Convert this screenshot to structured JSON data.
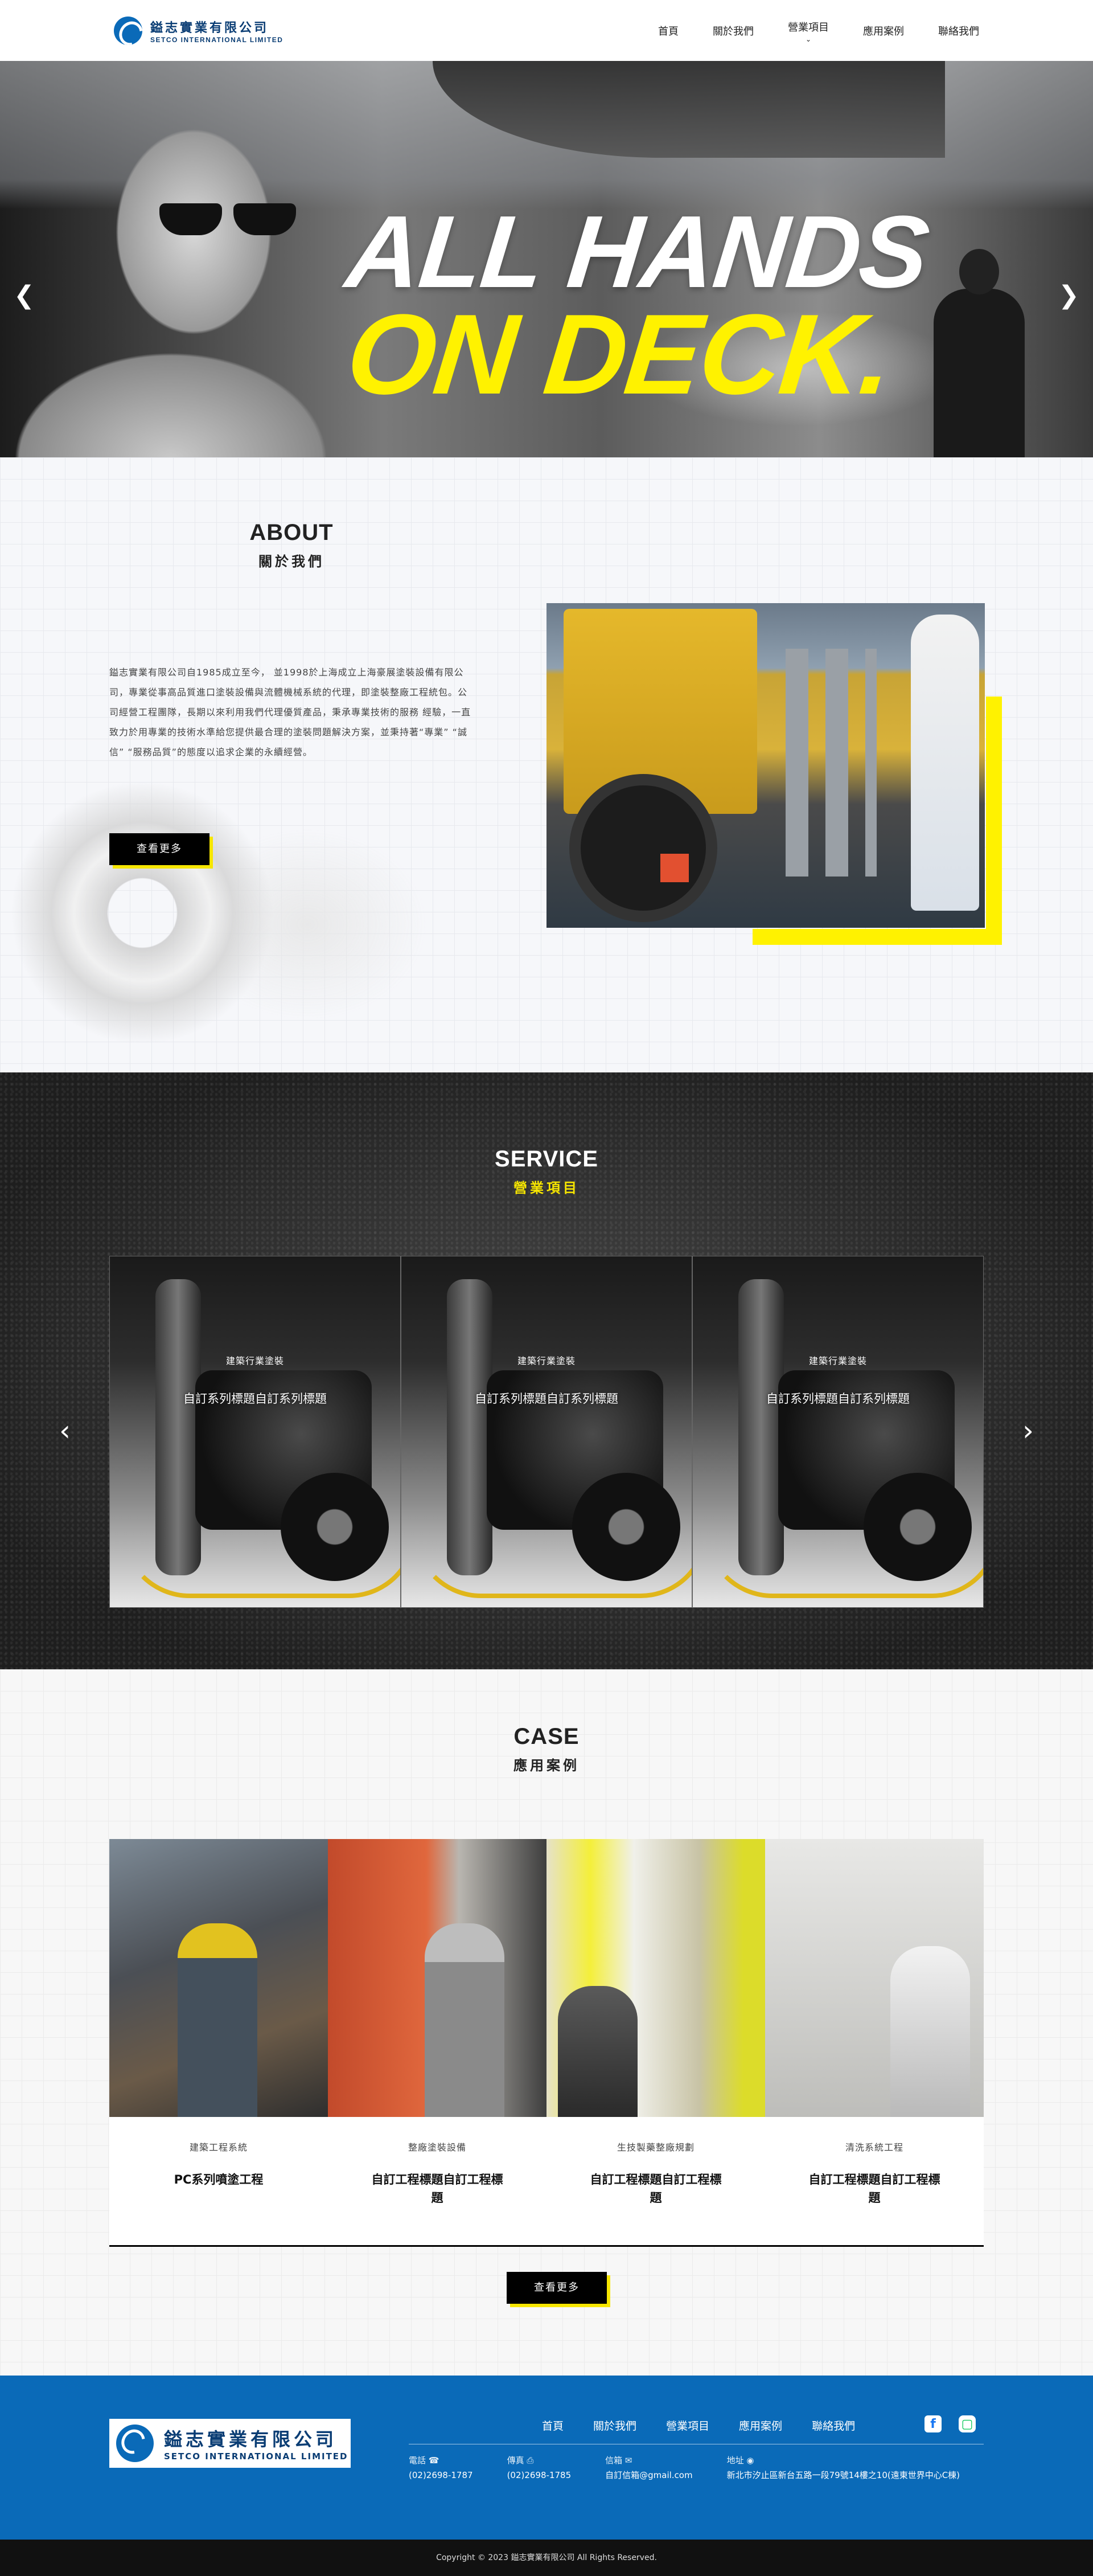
{
  "header": {
    "logo_cn": "鎰志實業有限公司",
    "logo_en": "SETCO INTERNATIONAL LIMITED",
    "nav": [
      "首頁",
      "關於我們",
      "營業項目",
      "應用案例",
      "聯絡我們"
    ]
  },
  "hero": {
    "line1": "ALL HANDS",
    "line2": "ON DECK.",
    "slides": 3,
    "active_slide": 1
  },
  "about": {
    "title_en": "ABOUT",
    "title_cn": "關於我們",
    "body": "鎰志實業有限公司自1985成立至今， 並1998於上海成立上海豪展塗裝設備有限公司，專業從事高品質進口塗裝設備與流體機械系統的代理，即塗裝整廠工程統包。公司經營工程團隊，長期以來利用我們代理優質產品，秉承專業技術的服務 經驗，一直致力於用專業的技術水準給您提供最合理的塗裝問題解決方案，並秉持著“專業” “誠信” “服務品質”的態度以追求企業的永續經營。",
    "button": "查看更多"
  },
  "service": {
    "title_en": "SERVICE",
    "title_cn": "營業項目",
    "cards": [
      {
        "category": "建築行業塗裝",
        "title": "自訂系列標題自訂系列標題"
      },
      {
        "category": "建築行業塗裝",
        "title": "自訂系列標題自訂系列標題"
      },
      {
        "category": "建築行業塗裝",
        "title": "自訂系列標題自訂系列標題"
      }
    ]
  },
  "case": {
    "title_en": "CASE",
    "title_cn": "應用案例",
    "cards": [
      {
        "category": "建築工程系統",
        "title": "PC系列噴塗工程"
      },
      {
        "category": "整廠塗裝設備",
        "title": "自訂工程標題自訂工程標題"
      },
      {
        "category": "生技製藥整廠規劃",
        "title": "自訂工程標題自訂工程標題"
      },
      {
        "category": "清洗系統工程",
        "title": "自訂工程標題自訂工程標題"
      }
    ],
    "button": "查看更多"
  },
  "footer": {
    "logo_cn": "鎰志實業有限公司",
    "logo_en": "SETCO INTERNATIONAL LIMITED",
    "nav": [
      "首頁",
      "關於我們",
      "營業項目",
      "應用案例",
      "聯絡我們"
    ],
    "phone_label": "電話",
    "phone": "(02)2698-1787",
    "fax_label": "傳真",
    "fax": "(02)2698-1785",
    "email_label": "信箱",
    "email": "自訂信箱@gmail.com",
    "address_label": "地址",
    "address": "新北市汐止區新台五路一段79號14樓之10(遠東世界中心C棟)",
    "copyright": "Copyright © 2023 鎰志實業有限公司 All Rights Reserved."
  },
  "colors": {
    "accent_yellow": "#fff200",
    "brand_blue": "#0a6ab8",
    "footer_bar": "#111111"
  }
}
